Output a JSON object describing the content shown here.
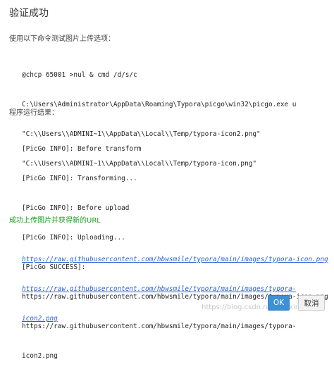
{
  "dialog": {
    "title": "验证成功",
    "command_label": "使用以下命令测试图片上传选项：",
    "command_lines": [
      "@chcp 65001 >nul & cmd /d/s/c",
      "C:\\Users\\Administrator\\AppData\\Roaming\\Typora\\picgo\\win32\\picgo.exe u",
      "\"C:\\\\Users\\\\ADMINI~1\\\\AppData\\\\Local\\\\Temp/typora-icon2.png\"",
      "\"C:\\\\Users\\\\ADMINI~1\\\\AppData\\\\Local\\\\Temp/typora-icon.png\""
    ],
    "result_label": "程序运行结果：",
    "result_lines": [
      "[PicGo INFO]: Before transform",
      "[PicGo INFO]: Transforming...",
      "[PicGo INFO]: Before upload",
      "[PicGo INFO]: Uploading...",
      "[PicGo SUCCESS]:",
      "https://raw.githubusercontent.com/hbwsmile/typora/main/images/typora-icon.png",
      "https://raw.githubusercontent.com/hbwsmile/typora/main/images/typora-",
      "icon2.png"
    ],
    "success_label": "成功上传图片并获得新的URL",
    "urls": [
      "https://raw.githubusercontent.com/hbwsmile/typora/main/images/typora-icon.png",
      "https://raw.githubusercontent.com/hbwsmile/typora/main/images/typora-",
      "icon2.png"
    ],
    "ok_label": "OK",
    "cancel_label": "取消"
  },
  "watermark": "https://blog.csdn.net/weixin_4..."
}
